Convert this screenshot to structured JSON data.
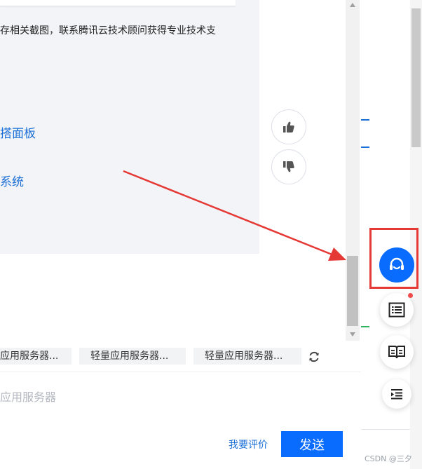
{
  "message": {
    "text": "存相关截图，联系腾讯云技术顾问获得专业技术支",
    "links": [
      "搭面板",
      "系统"
    ]
  },
  "suggestions": [
    "应用服务器...",
    "轻量应用服务器...",
    "轻量应用服务器..."
  ],
  "input": {
    "placeholder": "应用服务器"
  },
  "actions": {
    "rate": "我要评价",
    "send": "发送"
  },
  "watermark": "CSDN @三夕",
  "icons": {
    "thumb_up": "thumb-up-icon",
    "thumb_down": "thumb-down-icon",
    "refresh": "refresh-icon",
    "customer_service": "headset-icon",
    "list": "list-icon",
    "book": "book-icon",
    "outdent": "outdent-icon"
  },
  "colors": {
    "accent": "#0a6cff",
    "link": "#1a6fd6",
    "highlight": "#e53935",
    "arrow": "#e53935"
  }
}
